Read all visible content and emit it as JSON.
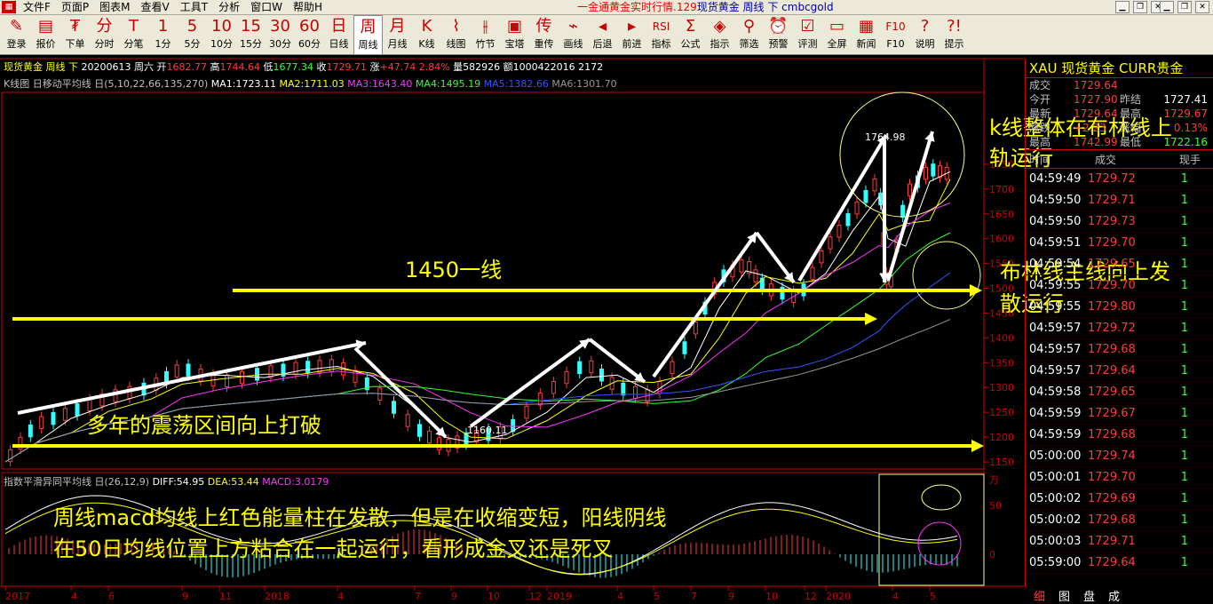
{
  "menubar": {
    "items": [
      "文件F",
      "页面P",
      "图表M",
      "查看V",
      "工具T",
      "分析",
      "窗口W",
      "帮助H"
    ],
    "window_title": "一金通黄金实时行情.129",
    "window_title_blue": "现货黄金 周线 下 cmbcgold"
  },
  "toolbar": [
    {
      "g": "✎",
      "l": "登录"
    },
    {
      "g": "▤",
      "l": "报价"
    },
    {
      "g": "₮",
      "l": "下单"
    },
    {
      "g": "分",
      "l": "分时"
    },
    {
      "g": "T",
      "l": "分笔"
    },
    {
      "g": "1",
      "l": "1分"
    },
    {
      "g": "5",
      "l": "5分"
    },
    {
      "g": "10",
      "l": "10分"
    },
    {
      "g": "15",
      "l": "15分"
    },
    {
      "g": "30",
      "l": "30分"
    },
    {
      "g": "60",
      "l": "60分"
    },
    {
      "g": "日",
      "l": "日线"
    },
    {
      "g": "周",
      "l": "周线"
    },
    {
      "g": "月",
      "l": "月线"
    },
    {
      "g": "K",
      "l": "K线"
    },
    {
      "g": "⌇",
      "l": "线图"
    },
    {
      "g": "⫲",
      "l": "竹节"
    },
    {
      "g": "▣",
      "l": "宝塔"
    },
    {
      "g": "传",
      "l": "重传"
    },
    {
      "g": "⌁",
      "l": "画线"
    },
    {
      "g": "◂",
      "l": "后退"
    },
    {
      "g": "▸",
      "l": "前进"
    },
    {
      "g": "RSI",
      "l": "指标"
    },
    {
      "g": "Σ",
      "l": "公式"
    },
    {
      "g": "◈",
      "l": "指示"
    },
    {
      "g": "⚲",
      "l": "筛选"
    },
    {
      "g": "⏰",
      "l": "预警"
    },
    {
      "g": "☑",
      "l": "评测"
    },
    {
      "g": "▭",
      "l": "全屏"
    },
    {
      "g": "▦",
      "l": "新闻"
    },
    {
      "g": "F10",
      "l": "F10"
    },
    {
      "g": "?",
      "l": "说明"
    },
    {
      "g": "?!",
      "l": "提示"
    }
  ],
  "info1": {
    "name": "现货黄金 周线 下",
    "date": "20200613 周六",
    "open_label": "开",
    "open": "1682.77",
    "high_label": "高",
    "high": "1744.64",
    "low_label": "低",
    "low": "1677.34",
    "close_label": "收",
    "close": "1729.71",
    "change_label": "涨",
    "change": "+47.74",
    "pct": "2.84%",
    "vol_label": "量",
    "vol": "582926",
    "amt_label": "额",
    "amt": "1000422016",
    "extra": "2172"
  },
  "info2": {
    "title": "K线图 日移动平均线 日(5,10,22,66,135,270)",
    "ma1": "MA1:1723.11",
    "ma2": "MA2:1711.03",
    "ma3": "MA3:1643.40",
    "ma4": "MA4:1495.19",
    "ma5": "MA5:1382.66",
    "ma6": "MA6:1301.70"
  },
  "macd_info": {
    "title": "指数平滑异同平均线 日(26,12,9)",
    "diff": "DIFF:54.95",
    "dea": "DEA:53.44",
    "macd": "MACD:3.0179"
  },
  "price_axis": [
    "1750",
    "1700",
    "1650",
    "1600",
    "1550",
    "1500",
    "1450",
    "1400",
    "1350",
    "1300",
    "1250",
    "1200",
    "1150"
  ],
  "macd_axis": [
    "万",
    "50",
    "0"
  ],
  "x_axis": [
    "2017",
    "4",
    "6",
    "9",
    "11",
    "2018",
    "4",
    "7",
    "9",
    "10",
    "12",
    "2019",
    "4",
    "5",
    "7",
    "9",
    "10",
    "12",
    "2020",
    "4",
    "5"
  ],
  "labels": {
    "high": "1764.98",
    "low": "1160.11"
  },
  "notes": {
    "n1": "k线整体在布林线上",
    "n1b": "轨运行",
    "n2": "布林线主线向上发",
    "n2b": "散运行",
    "n3": "1450一线",
    "n4": "多年的震荡区间向上打破",
    "n5": "周线macd均线上红色能量柱在发散，但是在收缩变短，阳线阴线",
    "n5b": "在50日均线位置上方粘合在一起运行，看形成金叉还是死叉"
  },
  "quote": {
    "header": "XAU  现货黄金  CURR贵金",
    "rows": [
      {
        "l": "成交",
        "v": "1729.64",
        "l2": "",
        "v2": ""
      },
      {
        "l": "今开",
        "v": "1727.90",
        "l2": "昨结",
        "v2": "1727.41"
      },
      {
        "l": "最新",
        "v": "1729.64",
        "l2": "最高",
        "v2": "1729.67"
      },
      {
        "l": "涨跌",
        "v": "+2.23",
        "l2": "涨幅",
        "v2": "0.13%"
      },
      {
        "l": "最高",
        "v": "1742.99",
        "l2": "最低",
        "v2": "1722.16"
      }
    ]
  },
  "ticks_header": {
    "t": "时间",
    "p": "成交",
    "v": "现手"
  },
  "ticks": [
    {
      "t": "04:59:49",
      "p": "1729.72",
      "v": "1"
    },
    {
      "t": "04:59:50",
      "p": "1729.71",
      "v": "1"
    },
    {
      "t": "04:59:50",
      "p": "1729.73",
      "v": "1"
    },
    {
      "t": "04:59:51",
      "p": "1729.70",
      "v": "1"
    },
    {
      "t": "04:59:54",
      "p": "1729.65",
      "v": "1"
    },
    {
      "t": "04:59:55",
      "p": "1729.70",
      "v": "1"
    },
    {
      "t": "04:59:55",
      "p": "1729.80",
      "v": "1"
    },
    {
      "t": "04:59:57",
      "p": "1729.72",
      "v": "1"
    },
    {
      "t": "04:59:57",
      "p": "1729.68",
      "v": "1"
    },
    {
      "t": "04:59:57",
      "p": "1729.64",
      "v": "1"
    },
    {
      "t": "04:59:58",
      "p": "1729.65",
      "v": "1"
    },
    {
      "t": "04:59:59",
      "p": "1729.67",
      "v": "1"
    },
    {
      "t": "04:59:59",
      "p": "1729.68",
      "v": "1"
    },
    {
      "t": "05:00:00",
      "p": "1729.74",
      "v": "1"
    },
    {
      "t": "05:00:01",
      "p": "1729.70",
      "v": "1"
    },
    {
      "t": "05:00:02",
      "p": "1729.69",
      "v": "1"
    },
    {
      "t": "05:00:02",
      "p": "1729.68",
      "v": "1"
    },
    {
      "t": "05:00:03",
      "p": "1729.71",
      "v": "1"
    },
    {
      "t": "05:59:00",
      "p": "1729.64",
      "v": "1"
    }
  ],
  "tabs": [
    "细",
    "图",
    "盘",
    "成"
  ]
}
